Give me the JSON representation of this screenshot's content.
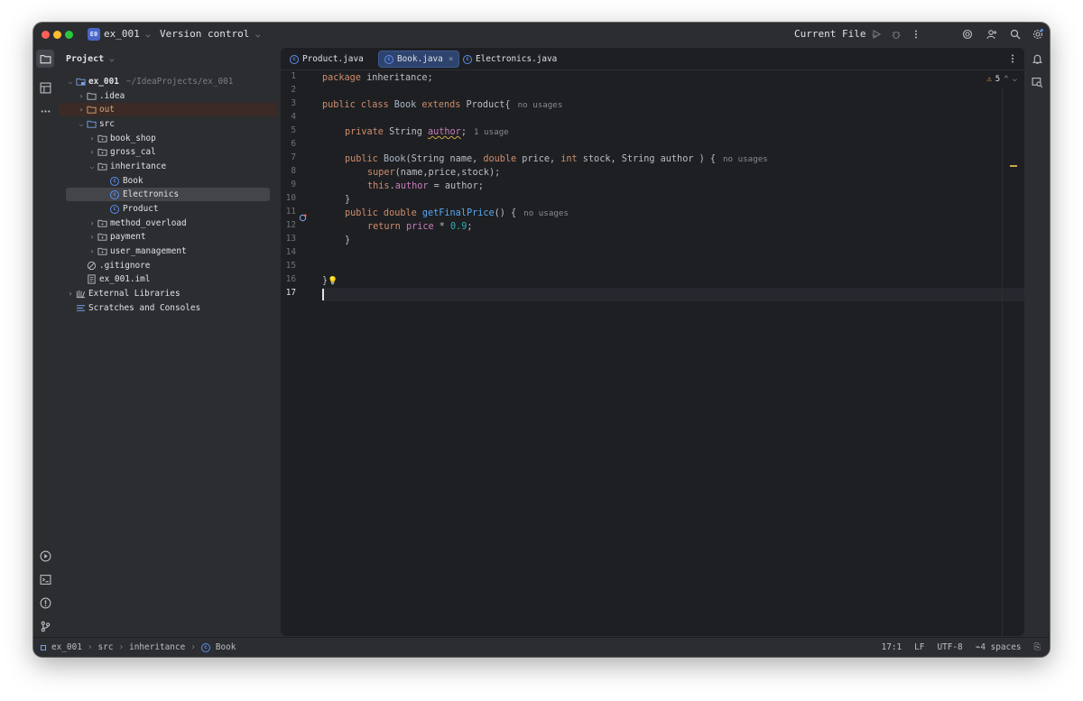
{
  "titlebar": {
    "project_badge": "E0",
    "project_name": "ex_001",
    "vcs_label": "Version control",
    "run_config": "Current File"
  },
  "project_panel": {
    "title": "Project",
    "root_name": "ex_001",
    "root_path": "~/IdeaProjects/ex_001",
    "items": [
      {
        "label": ".idea"
      },
      {
        "label": "out"
      },
      {
        "label": "src"
      },
      {
        "label": "book_shop"
      },
      {
        "label": "gross_cal"
      },
      {
        "label": "inheritance"
      },
      {
        "label": "Book"
      },
      {
        "label": "Electronics"
      },
      {
        "label": "Product"
      },
      {
        "label": "method_overload"
      },
      {
        "label": "payment"
      },
      {
        "label": "user_management"
      },
      {
        "label": ".gitignore"
      },
      {
        "label": "ex_001.iml"
      },
      {
        "label": "External Libraries"
      },
      {
        "label": "Scratches and Consoles"
      }
    ]
  },
  "tabs": [
    {
      "label": "Product.java"
    },
    {
      "label": "Book.java"
    },
    {
      "label": "Electronics.java"
    }
  ],
  "editor": {
    "line_numbers": [
      "1",
      "2",
      "3",
      "4",
      "5",
      "6",
      "7",
      "8",
      "9",
      "10",
      "11",
      "12",
      "13",
      "14",
      "15",
      "16",
      "17"
    ],
    "warning_count": "5",
    "hints": {
      "class_usages": "no usages",
      "field_usages": "1 usage",
      "ctor_usages": "no usages",
      "method_usages": "no usages"
    },
    "code": {
      "l1": "package inheritance;",
      "l3_kw": "public class ",
      "l3_name": "Book",
      "l3_ext": " extends ",
      "l3_parent": "Product{",
      "l5_kw": "private ",
      "l5_type": "String ",
      "l5_field": "author",
      "l5_end": ";",
      "l7_kw": "public ",
      "l7_name": "Book",
      "l7_p1": "(String name, ",
      "l7_kw2": "double",
      "l7_p2": " price, ",
      "l7_kw3": "int",
      "l7_p3": " stock, String author ) {",
      "l8_kw": "super",
      "l8_rest": "(name,price,stock);",
      "l9_kw": "this",
      "l9_dot": ".",
      "l9_field": "author",
      "l9_rest": " = author;",
      "l10": "}",
      "l11_kw": "public double ",
      "l11_fn": "getFinalPrice",
      "l11_rest": "() {",
      "l12_kw": "return ",
      "l12_field": "price",
      "l12_op": " * ",
      "l12_num": "0.9",
      "l12_end": ";",
      "l13": "}",
      "l16": "}"
    }
  },
  "statusbar": {
    "crumbs": [
      "ex_001",
      "src",
      "inheritance",
      "Book"
    ],
    "position": "17:1",
    "line_sep": "LF",
    "encoding": "UTF-8",
    "indent": "4 spaces"
  },
  "colors": {
    "keyword": "#cf8e6d",
    "field": "#c77dbb",
    "function": "#56a8f5",
    "number": "#2aacb8",
    "accent": "#4a66c8"
  }
}
